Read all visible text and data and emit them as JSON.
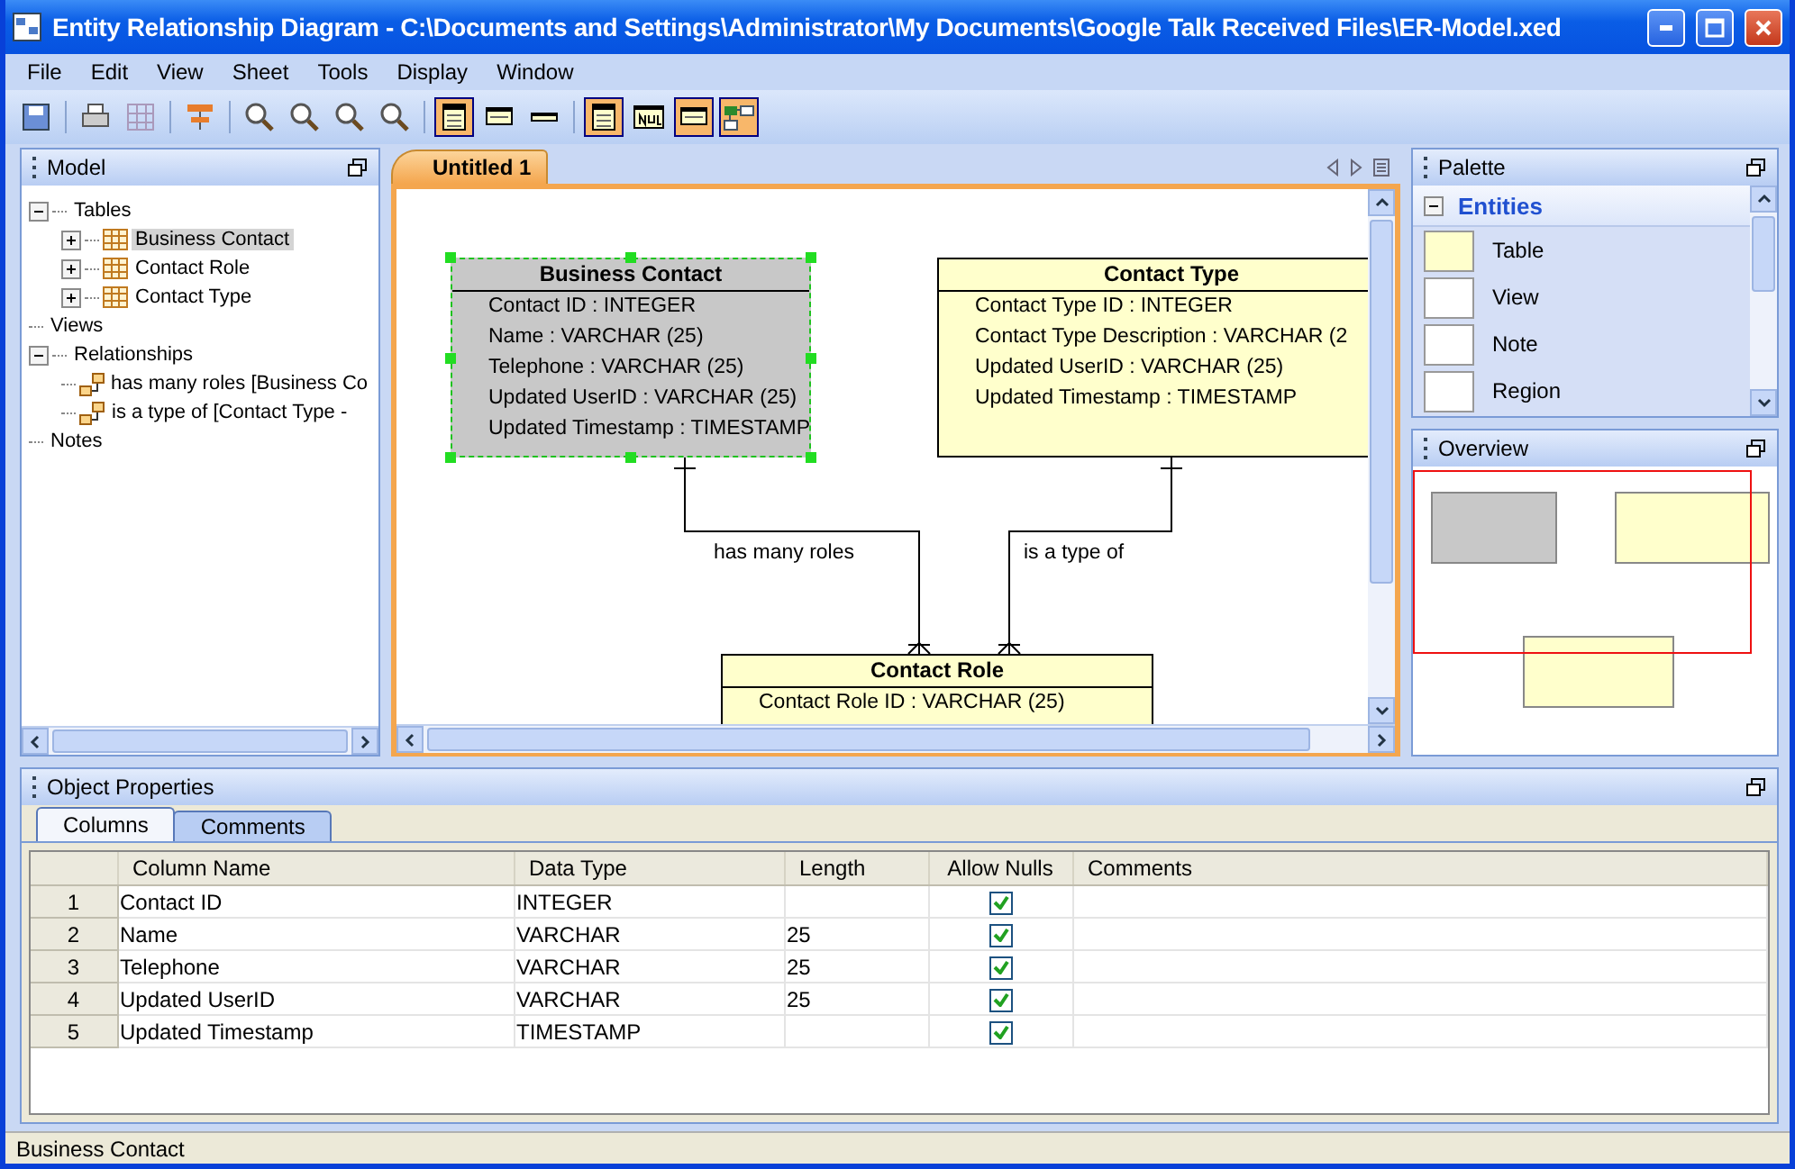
{
  "window": {
    "title": "Entity Relationship Diagram - C:\\Documents and Settings\\Administrator\\My Documents\\Google Talk Received Files\\ER-Model.xed"
  },
  "menu": [
    "File",
    "Edit",
    "View",
    "Sheet",
    "Tools",
    "Display",
    "Window"
  ],
  "toolbar": [
    {
      "kind": "save",
      "on": false
    },
    {
      "kind": "sep"
    },
    {
      "kind": "print",
      "on": false
    },
    {
      "kind": "grid",
      "on": false
    },
    {
      "kind": "sep"
    },
    {
      "kind": "layout",
      "on": false
    },
    {
      "kind": "sep"
    },
    {
      "kind": "zoom",
      "on": false
    },
    {
      "kind": "zoom",
      "on": false
    },
    {
      "kind": "zoom",
      "on": false
    },
    {
      "kind": "zoom",
      "on": false
    },
    {
      "kind": "sep"
    },
    {
      "kind": "entity",
      "on": true
    },
    {
      "kind": "brief",
      "on": false
    },
    {
      "kind": "title",
      "on": false
    },
    {
      "kind": "sep"
    },
    {
      "kind": "entity",
      "on": true
    },
    {
      "kind": "null",
      "on": false
    },
    {
      "kind": "brief",
      "on": true
    },
    {
      "kind": "relation",
      "on": true
    }
  ],
  "model": {
    "title": "Model",
    "tree": [
      {
        "label": "Tables",
        "expanded": true,
        "selected": false,
        "children": [
          {
            "label": "Business Contact",
            "kind": "table",
            "expanded": false,
            "selected": true
          },
          {
            "label": "Contact Role",
            "kind": "table",
            "expanded": false,
            "selected": false
          },
          {
            "label": "Contact Type",
            "kind": "table",
            "expanded": false,
            "selected": false
          }
        ]
      },
      {
        "label": "Views",
        "selected": false
      },
      {
        "label": "Relationships",
        "expanded": true,
        "selected": false,
        "children": [
          {
            "label": "has many roles [Business Co",
            "kind": "relationship",
            "selected": false
          },
          {
            "label": "is a type of [Contact Type -",
            "kind": "relationship",
            "selected": false
          }
        ]
      },
      {
        "label": "Notes",
        "selected": false
      }
    ]
  },
  "document_tab": {
    "label": "Untitled 1",
    "selected": true
  },
  "diagram": {
    "entities": [
      {
        "name": "Business Contact",
        "selected": true,
        "fields": [
          "Contact ID : INTEGER",
          "Name : VARCHAR (25)",
          "Telephone : VARCHAR (25)",
          "Updated UserID : VARCHAR (25)",
          "Updated Timestamp : TIMESTAMP"
        ]
      },
      {
        "name": "Contact Type",
        "selected": false,
        "fields": [
          "Contact Type ID : INTEGER",
          "Contact Type Description : VARCHAR (2",
          "Updated UserID : VARCHAR (25)",
          "Updated Timestamp : TIMESTAMP"
        ]
      },
      {
        "name": "Contact Role",
        "selected": false,
        "fields": [
          "Contact Role ID : VARCHAR (25)"
        ]
      }
    ],
    "relationships": [
      {
        "label": "has many roles"
      },
      {
        "label": "is a type of"
      }
    ]
  },
  "palette": {
    "title": "Palette",
    "section": "Entities",
    "expanded": true,
    "items": [
      "Table",
      "View",
      "Note",
      "Region"
    ]
  },
  "overview": {
    "title": "Overview"
  },
  "properties": {
    "title": "Object Properties",
    "tabs": [
      {
        "label": "Columns",
        "selected": true
      },
      {
        "label": "Comments",
        "selected": false
      }
    ],
    "columns": [
      "Column Name",
      "Data Type",
      "Length",
      "Allow Nulls",
      "Comments"
    ],
    "rows": [
      {
        "index": "1",
        "name": "Contact ID",
        "type": "INTEGER",
        "allow_nulls": true
      },
      {
        "index": "2",
        "name": "Name",
        "type": "VARCHAR",
        "length": "25",
        "allow_nulls": true
      },
      {
        "index": "3",
        "name": "Telephone",
        "type": "VARCHAR",
        "length": "25",
        "allow_nulls": true
      },
      {
        "index": "4",
        "name": "Updated UserID",
        "type": "VARCHAR",
        "length": "25",
        "allow_nulls": true
      },
      {
        "index": "5",
        "name": "Updated Timestamp",
        "type": "TIMESTAMP",
        "allow_nulls": true
      }
    ]
  },
  "status_bar": "Business Contact"
}
